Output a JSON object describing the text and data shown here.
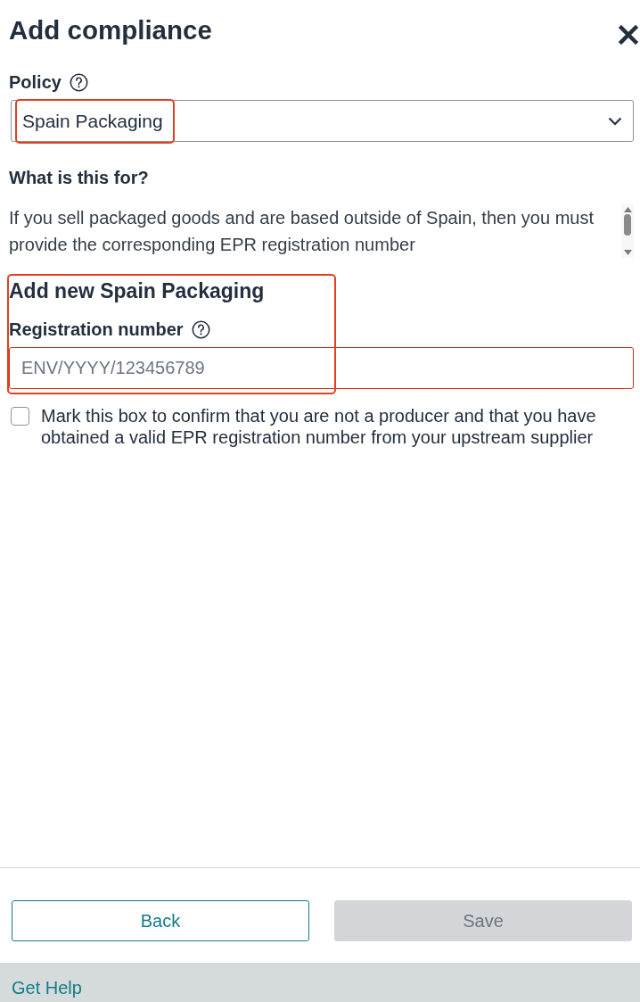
{
  "dialog": {
    "title": "Add compliance"
  },
  "policy": {
    "label": "Policy",
    "value": "Spain Packaging",
    "highlighted": true
  },
  "about": {
    "heading": "What is this for?",
    "text": "If you sell packaged goods and are based outside of Spain, then you must provide the corresponding EPR registration number"
  },
  "new_entry": {
    "heading": "Add new Spain Packaging",
    "highlighted": true,
    "field": {
      "label": "Registration number",
      "placeholder": "ENV/YYYY/123456789",
      "invalid": true
    }
  },
  "confirmation": {
    "text": "Mark this box to confirm that you are not a producer and that you have obtained a valid EPR registration number from your upstream supplier",
    "checked": false
  },
  "buttons": [
    {
      "label": "Back",
      "kind": "secondary",
      "disabled": false
    },
    {
      "label": "Save",
      "kind": "primary",
      "disabled": true
    }
  ],
  "footer": {
    "link": "Get Help"
  }
}
